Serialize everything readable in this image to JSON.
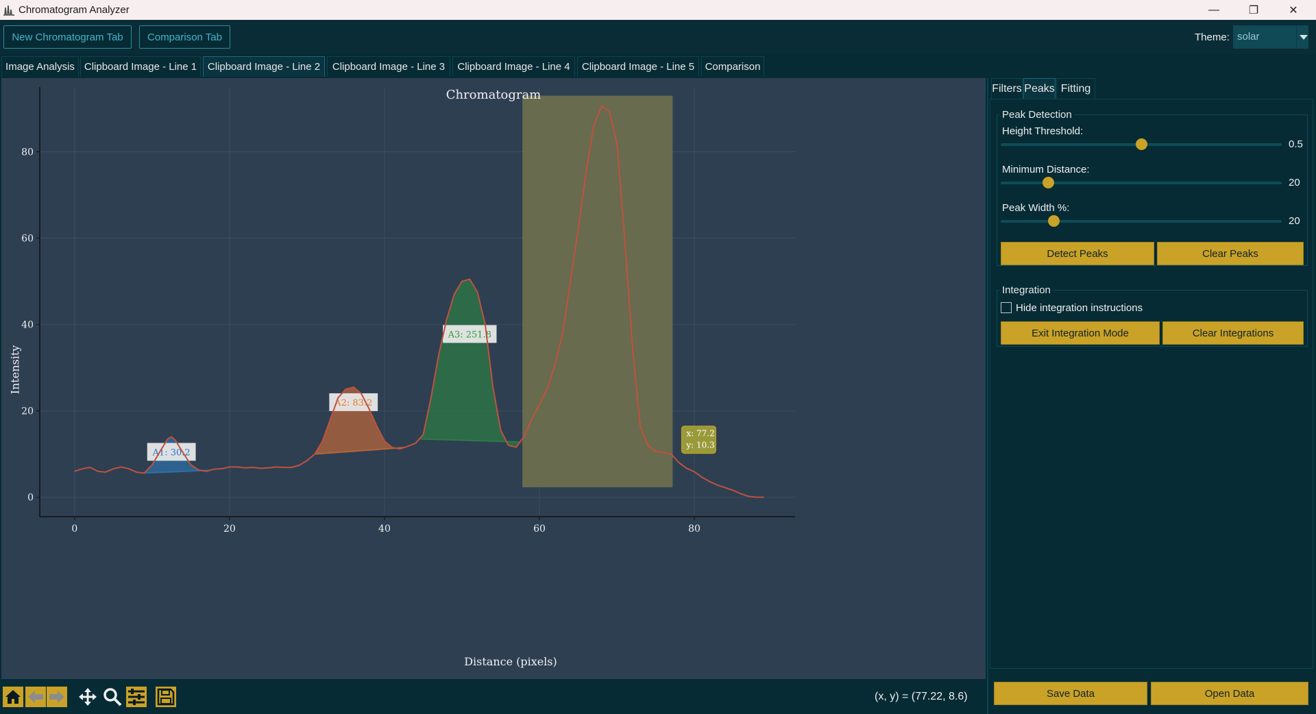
{
  "window": {
    "title": "Chromatogram Analyzer",
    "minimize": "—",
    "maximize": "❐",
    "close": "✕"
  },
  "toolbar": {
    "new_tab_label": "New Chromatogram Tab",
    "comparison_tab_label": "Comparison Tab",
    "theme_label": "Theme:",
    "theme_value": "solar"
  },
  "tabs": [
    {
      "label": "Image Analysis"
    },
    {
      "label": "Clipboard Image - Line 1"
    },
    {
      "label": "Clipboard Image - Line 2"
    },
    {
      "label": "Clipboard Image - Line 3"
    },
    {
      "label": "Clipboard Image - Line 4"
    },
    {
      "label": "Clipboard Image - Line 5"
    },
    {
      "label": "Comparison"
    }
  ],
  "active_tab": "Clipboard Image - Line 2",
  "colors": {
    "line": "#c0523e",
    "peak1": "#2f6fa3",
    "peak2": "#b5653a",
    "peak3": "#2e7a46",
    "selection": "#6b6e4e",
    "accent": "#c9a227"
  },
  "chart_data": {
    "type": "line",
    "title": "Chromatogram",
    "xlabel": "Distance (pixels)",
    "ylabel": "Intensity",
    "xlim": [
      -4.5,
      93
    ],
    "ylim": [
      -4.5,
      95
    ],
    "xticks": [
      0,
      20,
      40,
      60,
      80
    ],
    "yticks": [
      0,
      20,
      40,
      60,
      80
    ],
    "grid": true,
    "series": [
      {
        "x": [
          0,
          1,
          2,
          3,
          4,
          5,
          6,
          7,
          8,
          9,
          10,
          11,
          12,
          12.5,
          13,
          14,
          15,
          16,
          17,
          18,
          19,
          20,
          21,
          22,
          23,
          24,
          25,
          26,
          27,
          28,
          29,
          30,
          31,
          32,
          33,
          34,
          35,
          36,
          37,
          38,
          39,
          40,
          41,
          42,
          43,
          44,
          45,
          46,
          47,
          48,
          49,
          50,
          51,
          52,
          53,
          54,
          55,
          56,
          57,
          58,
          59,
          60,
          61,
          62,
          63,
          64,
          65,
          66,
          67,
          68,
          69,
          70,
          71,
          72,
          73,
          74,
          75,
          76,
          77,
          78,
          79,
          80,
          81,
          82,
          83,
          84,
          85,
          86,
          87,
          88,
          89
        ],
        "y": [
          6.0,
          6.6,
          6.9,
          6.0,
          5.8,
          6.6,
          7.0,
          6.6,
          5.8,
          5.6,
          7.5,
          10.5,
          13.5,
          14.0,
          13.2,
          10.3,
          7.5,
          6.3,
          6.0,
          6.5,
          6.6,
          7.0,
          7.0,
          6.8,
          6.9,
          6.7,
          6.8,
          7.0,
          6.9,
          6.9,
          7.4,
          8.5,
          10.0,
          13.0,
          18.0,
          23.0,
          25.0,
          25.5,
          24.0,
          20.5,
          16.5,
          13.0,
          11.5,
          11.2,
          11.8,
          12.5,
          14.5,
          23.0,
          33.0,
          41.0,
          47.0,
          50.0,
          50.5,
          47.5,
          40.0,
          25.5,
          15.5,
          12.0,
          11.6,
          14.0,
          18.0,
          21.5,
          25.0,
          30.5,
          38.0,
          50.0,
          62.0,
          75.0,
          86.0,
          90.5,
          89.5,
          82.0,
          60.0,
          35.0,
          16.5,
          12.0,
          10.6,
          10.4,
          10.0,
          8.0,
          6.7,
          5.9,
          4.6,
          3.6,
          2.8,
          2.2,
          1.6,
          0.8,
          0.2,
          0.0,
          0.0
        ]
      }
    ],
    "integrations": [
      {
        "label": "A1: 30.2",
        "x_start": 9,
        "x_end": 17.5,
        "color": "#2f6fa3",
        "text_color": "#2a6fc7"
      },
      {
        "label": "A2: 83.2",
        "x_start": 31,
        "x_end": 42.5,
        "color": "#b5653a",
        "text_color": "#e07b2a"
      },
      {
        "label": "A3: 251.8",
        "x_start": 44.5,
        "x_end": 57.5,
        "color": "#2e7a46",
        "text_color": "#2e9a3a"
      }
    ],
    "selection_span": [
      57.8,
      77.2
    ],
    "tooltip": {
      "x_text": "x: 77.2",
      "y_text": "y: 10.3"
    }
  },
  "status": {
    "coordinates": "(x, y) = (77.22, 8.6)"
  },
  "right_panel": {
    "tabs": [
      "Filters",
      "Peaks",
      "Fitting"
    ],
    "active_tab": "Peaks",
    "peak_detection": {
      "title": "Peak Detection",
      "height_label": "Height Threshold:",
      "height_value": "0.5",
      "height_fraction": 0.5,
      "distance_label": "Minimum Distance:",
      "distance_value": "20",
      "distance_fraction": 0.17,
      "width_label": "Peak Width %:",
      "width_value": "20",
      "width_fraction": 0.19,
      "detect_label": "Detect Peaks",
      "clear_label": "Clear Peaks"
    },
    "integration": {
      "title": "Integration",
      "hide_label": "Hide integration instructions",
      "hide_checked": false,
      "exit_label": "Exit Integration Mode",
      "clear_label": "Clear Integrations"
    },
    "save_label": "Save Data",
    "open_label": "Open Data"
  }
}
